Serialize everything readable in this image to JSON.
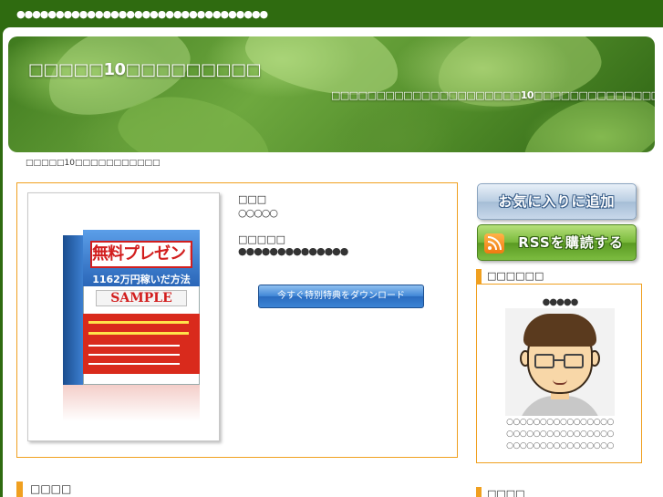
{
  "topbar": {
    "text": "●●●●●●●●●●●●●●●●●●●●●●●●●●●●●●●●"
  },
  "header": {
    "title": "□□□□□10□□□□□□□□□",
    "description": "□□□□□□□□□□□□□□□□□□□□□10□□□□□□□□□□□□□□□"
  },
  "breadcrumb": {
    "text": "□□□□□10□□□□□□□□□□□"
  },
  "product": {
    "image": {
      "banner": "無料プレゼント",
      "subtitle": "1162万円稼いだ方法",
      "sample": "SAMPLE"
    },
    "name_label": "□□□",
    "name_value": "○○○○○",
    "author_label": "□□□□□",
    "author_value": "●●●●●●●●●●●●●●",
    "download_label": "今すぐ特別特典をダウンロード"
  },
  "content": {
    "section_heading": "□□□□"
  },
  "sidebar": {
    "favorite_label": "お気に入りに追加",
    "rss_label": "RSSを購読する",
    "profile_heading": "□□□□□□",
    "profile_name": "●●●●●",
    "profile_lines": [
      "○○○○○○○○○○○○○○○○",
      "○○○○○○○○○○○○○○○○",
      "○○○○○○○○○○○○○○○○"
    ],
    "next_heading": "□□□□"
  },
  "colors": {
    "topbar": "#2f6b10",
    "accent_border": "#f0a020",
    "download_button": "#3f86d6",
    "rss_button": "#78b83a",
    "favorite_button": "#b9cde2"
  }
}
